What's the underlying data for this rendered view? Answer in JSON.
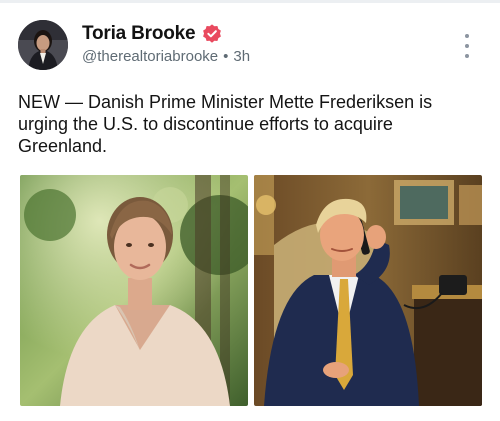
{
  "post": {
    "author": {
      "name": "Toria Brooke",
      "handle": "@therealtoriabrooke",
      "time": "3h",
      "separator": "•",
      "verified": true,
      "verified_color": "#e94a5f"
    },
    "text": "NEW — Danish Prime Minister Mette Frederiksen is urging the U.S. to discontinue efforts to acquire Greenland.",
    "media": [
      {
        "icon": "photo-woman-outdoors"
      },
      {
        "icon": "photo-man-on-phone"
      }
    ],
    "more_icon": "more-vertical-icon"
  }
}
